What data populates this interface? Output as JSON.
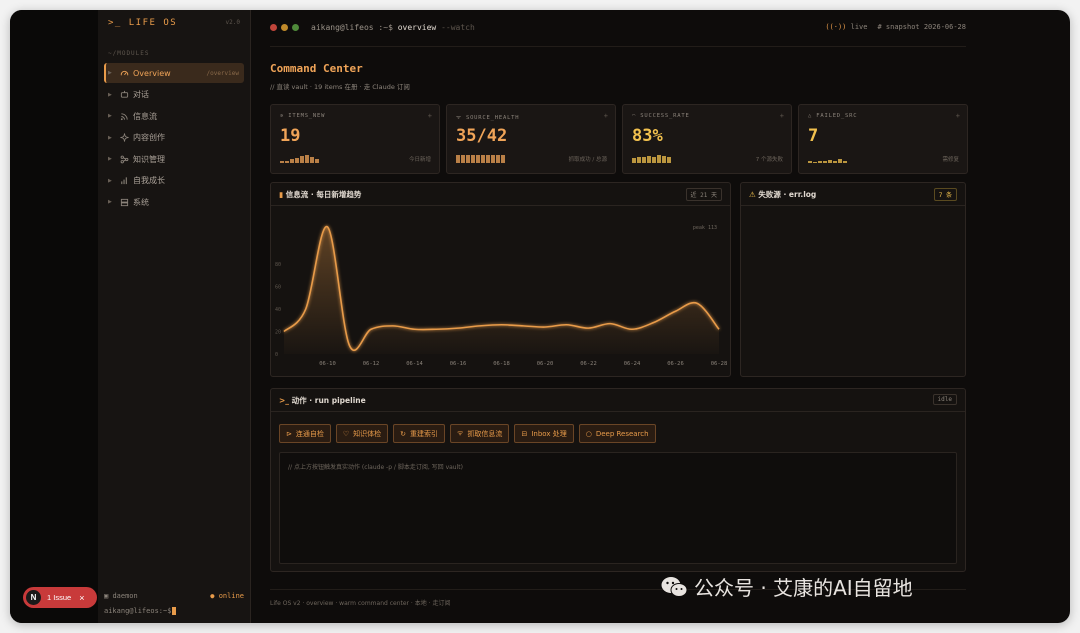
{
  "sidebar": {
    "brand": ">_ LIFE OS",
    "version": "v2.0",
    "modules_heading": "~/MODULES",
    "items": [
      {
        "label": "Overview",
        "route": "/overview",
        "icon": "gauge-icon"
      },
      {
        "label": "对话",
        "icon": "chat-bot-icon"
      },
      {
        "label": "信息流",
        "icon": "rss-icon"
      },
      {
        "label": "内容创作",
        "icon": "sparkle-icon"
      },
      {
        "label": "知识管理",
        "icon": "network-icon"
      },
      {
        "label": "自我成长",
        "icon": "bar-chart-icon"
      },
      {
        "label": "系统",
        "icon": "server-icon"
      }
    ],
    "daemon_label": "daemon",
    "daemon_status": "● online",
    "prompt": "aikang@lifeos:~$"
  },
  "topbar": {
    "user": "aikang@lifeos :~$",
    "command": "overview",
    "flag": "--watch",
    "live": "live",
    "snapshot": "# snapshot 2026-06-28"
  },
  "page": {
    "title": "Command Center",
    "subtitle": "// 直读 vault · 19 items 在册 · 走 Claude 订阅"
  },
  "stats": [
    {
      "label": "ITEMS_NEW",
      "value": "19",
      "note": "今日新增",
      "color": "#f0a458",
      "spark": [
        0.2,
        0.3,
        0.5,
        0.6,
        0.9,
        1.0,
        0.7,
        0.5
      ]
    },
    {
      "label": "SOURCE_HEALTH",
      "value": "35/42",
      "note": "抓取成功 / 总源",
      "color": "#f0a458",
      "spark": [
        1,
        1,
        1,
        1,
        1,
        1,
        1,
        1,
        1,
        1
      ]
    },
    {
      "label": "SUCCESS_RATE",
      "value": "83%",
      "note": "7 个源失败",
      "color": "#f2c14e",
      "spark": [
        0.6,
        0.8,
        0.7,
        0.9,
        0.8,
        1.0,
        0.9,
        0.8
      ]
    },
    {
      "label": "FAILED_SRC",
      "value": "7",
      "note": "需修复",
      "color": "#f2c14e",
      "spark": [
        0.2,
        0.1,
        0.3,
        0.2,
        0.4,
        0.2,
        0.5,
        0.3
      ]
    }
  ],
  "trend_panel": {
    "title": "信息流 · 每日新增趋势",
    "badge": "近 21 天",
    "peak_label": "peak 113"
  },
  "fail_panel": {
    "title": "失败源 · err.log",
    "badge": "7 条"
  },
  "action_panel": {
    "title": "动作 · run pipeline",
    "badge": "idle",
    "buttons": [
      {
        "label": "连通自检",
        "icon": "plug-icon"
      },
      {
        "label": "知识体检",
        "icon": "heart-pulse-icon"
      },
      {
        "label": "重建索引",
        "icon": "refresh-icon"
      },
      {
        "label": "抓取信息流",
        "icon": "rss-icon"
      },
      {
        "label": "Inbox 处理",
        "icon": "inbox-icon"
      },
      {
        "label": "Deep Research",
        "icon": "search-icon"
      }
    ],
    "console_hint": "// 点上方按钮触发真实动作 (claude -p / 脚本走订阅, 写回 vault)"
  },
  "footer": "Life OS v2 · overview · warm command center · 本地 · 走订阅",
  "issue_badge": {
    "n": "N",
    "label": "1 Issue"
  },
  "watermark": "公众号 · 艾康的AI自留地",
  "chart_data": {
    "type": "area",
    "x": [
      "06-08",
      "06-09",
      "06-10",
      "06-11",
      "06-12",
      "06-13",
      "06-14",
      "06-15",
      "06-16",
      "06-17",
      "06-18",
      "06-19",
      "06-20",
      "06-21",
      "06-22",
      "06-23",
      "06-24",
      "06-25",
      "06-26",
      "06-27",
      "06-28"
    ],
    "values": [
      20,
      40,
      113,
      8,
      22,
      25,
      22,
      22,
      23,
      25,
      26,
      25,
      24,
      26,
      23,
      27,
      22,
      28,
      38,
      45,
      22
    ],
    "y_ticks": [
      0,
      20,
      40,
      60,
      80
    ],
    "x_tick_labels": [
      "06-10",
      "06-12",
      "06-14",
      "06-16",
      "06-18",
      "06-20",
      "06-22",
      "06-24",
      "06-26",
      "06-28"
    ],
    "ylim": [
      0,
      120
    ],
    "grid": false,
    "color": "#e89b4a"
  }
}
